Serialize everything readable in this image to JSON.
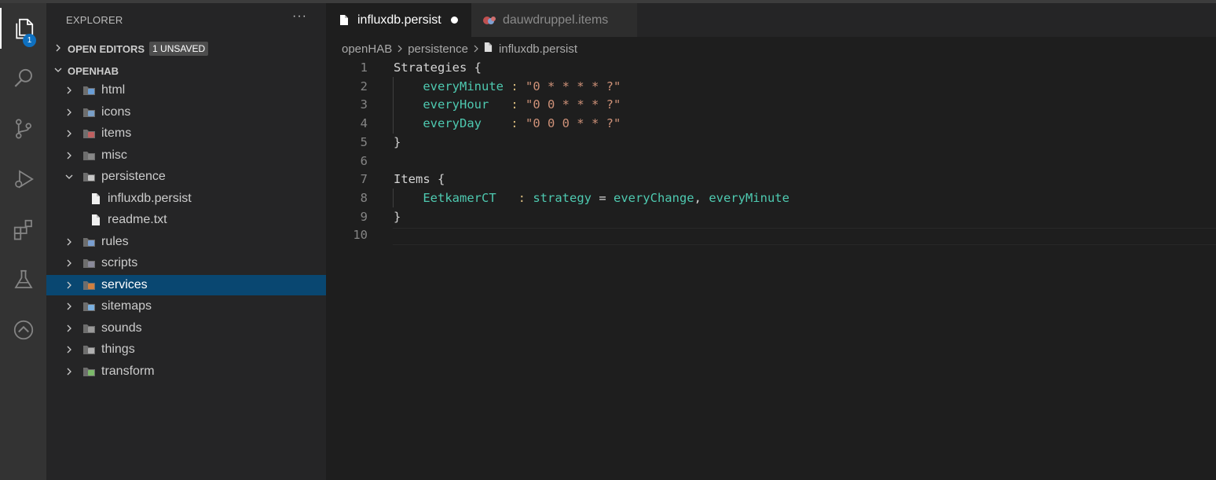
{
  "activity_bar": {
    "explorer_badge": "1",
    "items": [
      "files-icon",
      "search-icon",
      "source-control-icon",
      "run-debug-icon",
      "extensions-icon",
      "testing-icon",
      "openhab-icon"
    ]
  },
  "sidebar": {
    "header": "EXPLORER",
    "more": "···",
    "open_editors": {
      "label": "OPEN EDITORS",
      "badge": "1 UNSAVED"
    },
    "workspace": {
      "label": "OPENHAB"
    },
    "tree": [
      {
        "label": "html",
        "depth": 0,
        "kind": "folder",
        "expanded": false
      },
      {
        "label": "icons",
        "depth": 0,
        "kind": "folder",
        "expanded": false
      },
      {
        "label": "items",
        "depth": 0,
        "kind": "folder",
        "expanded": false
      },
      {
        "label": "misc",
        "depth": 0,
        "kind": "folder",
        "expanded": false
      },
      {
        "label": "persistence",
        "depth": 0,
        "kind": "folder",
        "expanded": true
      },
      {
        "label": "influxdb.persist",
        "depth": 1,
        "kind": "file"
      },
      {
        "label": "readme.txt",
        "depth": 1,
        "kind": "file"
      },
      {
        "label": "rules",
        "depth": 0,
        "kind": "folder",
        "expanded": false
      },
      {
        "label": "scripts",
        "depth": 0,
        "kind": "folder",
        "expanded": false
      },
      {
        "label": "services",
        "depth": 0,
        "kind": "folder",
        "expanded": false,
        "selected": true
      },
      {
        "label": "sitemaps",
        "depth": 0,
        "kind": "folder",
        "expanded": false
      },
      {
        "label": "sounds",
        "depth": 0,
        "kind": "folder",
        "expanded": false
      },
      {
        "label": "things",
        "depth": 0,
        "kind": "folder",
        "expanded": false
      },
      {
        "label": "transform",
        "depth": 0,
        "kind": "folder",
        "expanded": false
      }
    ]
  },
  "tabs": [
    {
      "label": "influxdb.persist",
      "active": true,
      "dirty": true
    },
    {
      "label": "dauwdruppel.items",
      "active": false,
      "dirty": false
    }
  ],
  "breadcrumb": [
    "openHAB",
    "persistence",
    "influxdb.persist"
  ],
  "editor": {
    "lines": [
      [
        [
          "p",
          "Strategies {"
        ]
      ],
      [
        [
          "p",
          "    "
        ],
        [
          "k",
          "everyMinute"
        ],
        [
          "o",
          " : "
        ],
        [
          "s",
          "\"0 * * * * ?\""
        ]
      ],
      [
        [
          "p",
          "    "
        ],
        [
          "k",
          "everyHour"
        ],
        [
          "o",
          "   : "
        ],
        [
          "s",
          "\"0 0 * * * ?\""
        ]
      ],
      [
        [
          "p",
          "    "
        ],
        [
          "k",
          "everyDay"
        ],
        [
          "o",
          "    : "
        ],
        [
          "s",
          "\"0 0 0 * * ?\""
        ]
      ],
      [
        [
          "p",
          "}"
        ]
      ],
      [],
      [
        [
          "p",
          "Items {"
        ]
      ],
      [
        [
          "p",
          "    "
        ],
        [
          "k",
          "EetkamerCT"
        ],
        [
          "o",
          "   : "
        ],
        [
          "k",
          "strategy"
        ],
        [
          "p",
          " = "
        ],
        [
          "k",
          "everyChange"
        ],
        [
          "p",
          ", "
        ],
        [
          "k",
          "everyMinute"
        ]
      ],
      [
        [
          "p",
          "}"
        ]
      ],
      []
    ]
  },
  "colors": {
    "accent": "#0e70c0",
    "selection": "#094771",
    "keyword": "#4ec9b0",
    "string": "#ce9178"
  }
}
